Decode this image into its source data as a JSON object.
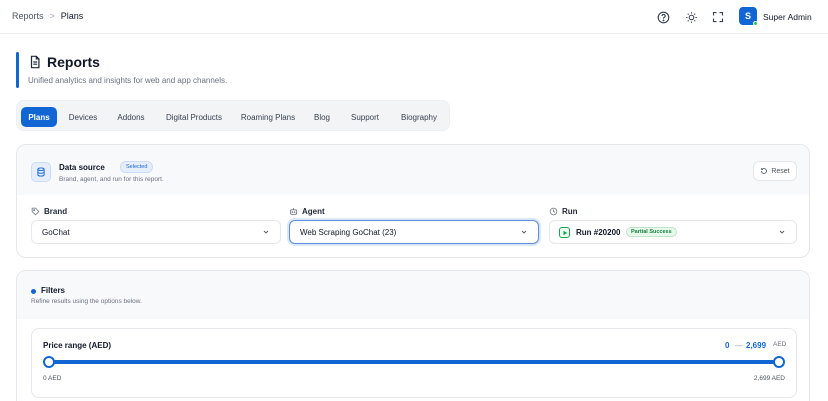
{
  "breadcrumb": {
    "parent": "Reports",
    "separator": ">",
    "current": "Plans"
  },
  "topbar": {
    "icons": [
      "help-icon",
      "theme-toggle-icon",
      "fullscreen-icon"
    ],
    "avatar_initial": "S",
    "username": "Super Admin"
  },
  "header": {
    "title": "Reports",
    "subtitle": "Unified analytics and insights for web and app channels."
  },
  "tabs": [
    {
      "label": "Plans",
      "active": true
    },
    {
      "label": "Devices",
      "active": false
    },
    {
      "label": "Addons",
      "active": false
    },
    {
      "label": "Digital Products",
      "active": false
    },
    {
      "label": "Roaming Plans",
      "active": false
    },
    {
      "label": "Blog",
      "active": false
    },
    {
      "label": "Support",
      "active": false
    },
    {
      "label": "Biography",
      "active": false
    }
  ],
  "datasource": {
    "title": "Data source",
    "badge": "Selected",
    "subtitle": "Brand, agent, and run for this report.",
    "reset_label": "Reset",
    "brand": {
      "label": "Brand",
      "value": "GoChat"
    },
    "agent": {
      "label": "Agent",
      "value": "Web Scraping GoChat (23)"
    },
    "run": {
      "label": "Run",
      "value": "Run #20200",
      "status": "Partial Success"
    }
  },
  "filters": {
    "title": "Filters",
    "subtitle": "Refine results using the options below.",
    "price": {
      "label": "Price range (AED)",
      "selected_min": "0",
      "dash": "—",
      "selected_max": "2,699",
      "unit": "AED",
      "range_min_label": "0 AED",
      "range_max_label": "2,699 AED",
      "range_min": 0,
      "range_max": 2699,
      "value_min": 0,
      "value_max": 2699
    }
  },
  "colors": {
    "accent": "#1266d4",
    "success": "#16a34a"
  }
}
